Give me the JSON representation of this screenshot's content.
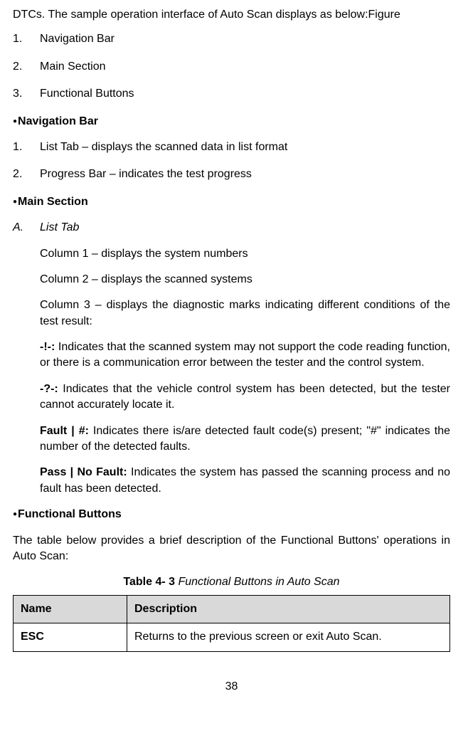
{
  "topLine": "DTCs. The sample operation interface of Auto Scan displays as below:Figure",
  "mainList": [
    {
      "num": "1.",
      "txt": "Navigation Bar"
    },
    {
      "num": "2.",
      "txt": "Main Section"
    },
    {
      "num": "3.",
      "txt": "Functional Buttons"
    }
  ],
  "navBar": {
    "heading": "Navigation Bar",
    "items": [
      {
        "num": "1.",
        "txt": "List Tab – displays the scanned data in list format"
      },
      {
        "num": "2.",
        "txt": "Progress Bar – indicates the test progress"
      }
    ]
  },
  "mainSection": {
    "heading": "Main Section",
    "a": {
      "num": "A.",
      "txt": "List Tab"
    },
    "cols": [
      "Column 1 – displays the system numbers",
      "Column 2 – displays the scanned systems",
      "Column 3 – displays the diagnostic marks indicating different conditions of the test result:"
    ],
    "defs": [
      {
        "lead": "-!-: ",
        "body": "Indicates that the scanned system may not support the code reading function, or there is a communication error between the tester and the control system."
      },
      {
        "lead": "-?-: ",
        "body": "Indicates that the vehicle control system has been detected, but the tester cannot accurately locate it."
      },
      {
        "lead": "Fault | #: ",
        "body": "Indicates there is/are detected fault code(s) present; \"#\" indicates the number of the detected faults."
      },
      {
        "lead": "Pass | No Fault: ",
        "body": "Indicates the system has passed the scanning process and no fault has been detected."
      }
    ]
  },
  "funcButtons": {
    "heading": "Functional Buttons",
    "intro": "The table below provides a brief description of the Functional Buttons' operations in Auto Scan:",
    "captionStrong": "Table 4- 3",
    "captionItal": " Functional Buttons in Auto Scan",
    "tableHead": {
      "c1": "Name",
      "c2": "Description"
    },
    "rows": [
      {
        "name": "ESC",
        "desc": "Returns to the previous screen or exit Auto Scan."
      }
    ]
  },
  "pageNum": "38"
}
